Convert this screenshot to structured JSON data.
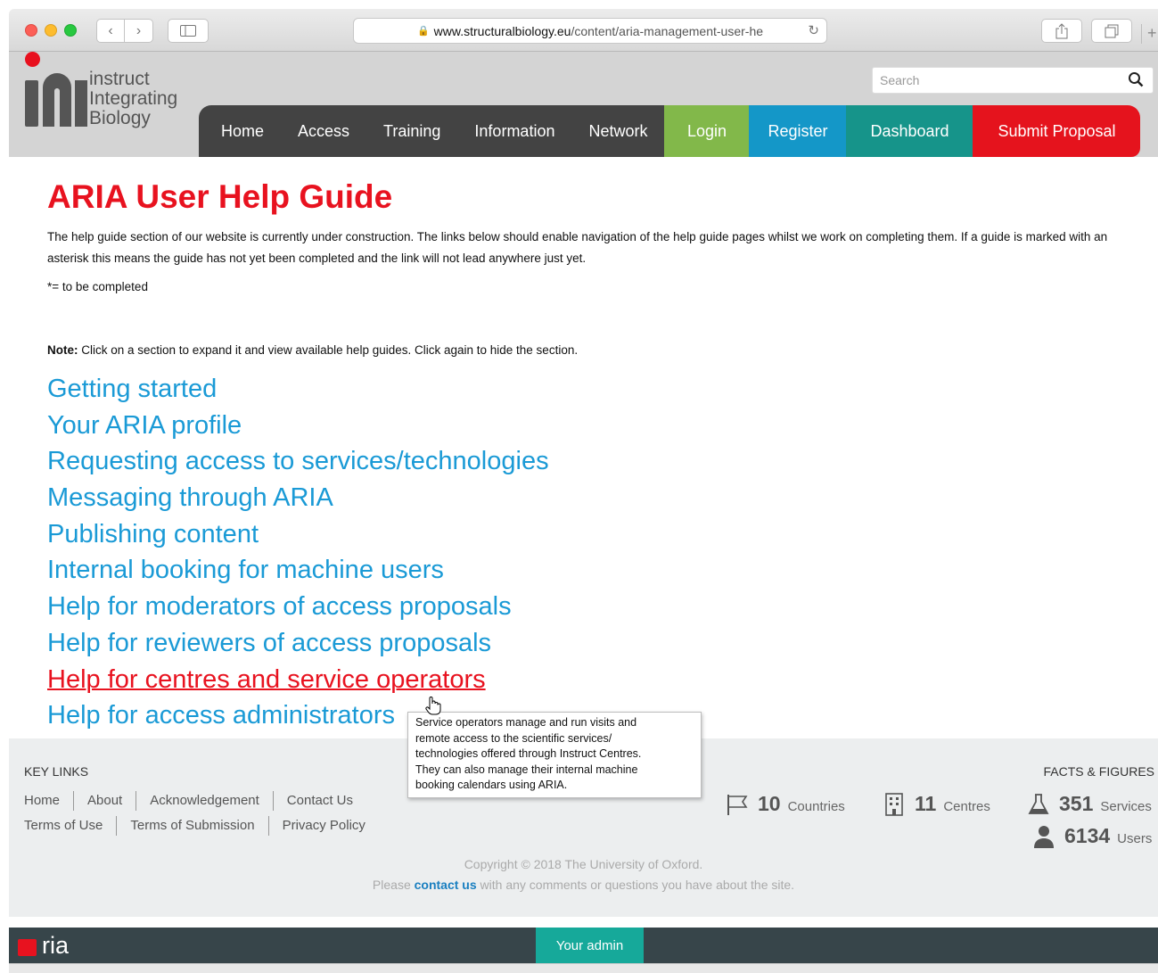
{
  "browser": {
    "url_domain": "www.structuralbiology.eu",
    "url_path": "/content/aria-management-user-he"
  },
  "header": {
    "logo_lines": [
      "instruct",
      "Integrating",
      "Biology"
    ],
    "search_placeholder": "Search"
  },
  "nav": {
    "items": [
      "Home",
      "Access",
      "Training",
      "Information",
      "Network"
    ],
    "login": "Login",
    "register": "Register",
    "dashboard": "Dashboard",
    "submit": "Submit Proposal",
    "colors": {
      "dark": "#434343",
      "login": "#82b84a",
      "register": "#1497c8",
      "dashboard": "#16948a",
      "submit": "#e5131d"
    }
  },
  "main": {
    "title": "ARIA User Help Guide",
    "intro": "The help guide section of our website is currently under construction. The links below should enable navigation of the help guide pages whilst we work on completing them. If a guide is marked with an asterisk this means the guide has not yet been completed and the link will not lead anywhere just yet.",
    "legend": "*= to be completed",
    "note_label": "Note:",
    "note_text": " Click on a section to expand it and view available help guides. Click again to hide the section.",
    "guides": [
      "Getting started",
      "Your ARIA profile",
      "Requesting access to services/technologies",
      "Messaging through ARIA",
      "Publishing content",
      "Internal booking for machine users",
      "Help for moderators of access proposals",
      "Help for reviewers of access proposals",
      "Help for centres and service operators",
      "Help for access administrators"
    ],
    "active_guide_index": 8
  },
  "tooltip": {
    "lines": [
      "Service operators manage and run visits and",
      "remote access to the scientific services/",
      "technologies offered through Instruct Centres.",
      "They can also manage their internal machine",
      "booking calendars using ARIA."
    ]
  },
  "footer": {
    "key_links_title": "KEY LINKS",
    "links_row1": [
      "Home",
      "About",
      "Acknowledgement",
      "Contact Us"
    ],
    "links_row2": [
      "Terms of Use",
      "Terms of Submission",
      "Privacy Policy"
    ],
    "facts_title": "FACTS & FIGURES",
    "facts": [
      {
        "icon": "flag-icon",
        "value": "10",
        "label": "Countries"
      },
      {
        "icon": "building-icon",
        "value": "11",
        "label": "Centres"
      },
      {
        "icon": "flask-icon",
        "value": "351",
        "label": "Services"
      },
      {
        "icon": "user-icon",
        "value": "6134",
        "label": "Users"
      }
    ],
    "copyright": "Copyright © 2018 The University of Oxford.",
    "contact_pre": "Please ",
    "contact_link": "contact us",
    "contact_post": " with any comments or questions you have about the site."
  },
  "aria_bar": {
    "logo_text": "ria",
    "your_admin": "Your admin"
  }
}
